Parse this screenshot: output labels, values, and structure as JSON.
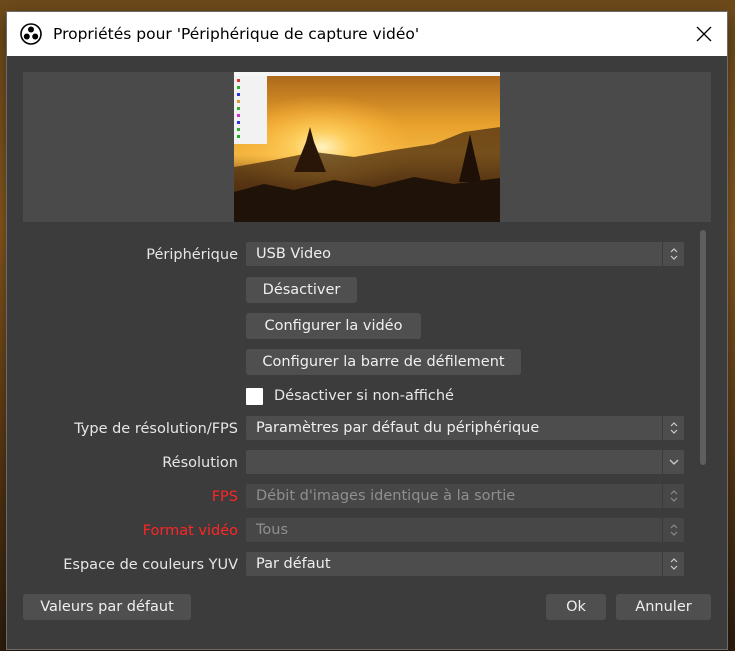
{
  "window": {
    "title": "Propriétés pour 'Périphérique de capture vidéo'"
  },
  "form": {
    "device_label": "Périphérique",
    "device_value": "USB Video",
    "deactivate_button": "Désactiver",
    "configure_video_button": "Configurer la vidéo",
    "configure_crossbar_button": "Configurer la barre de défilement",
    "deactivate_hidden_label": "Désactiver si non-affiché",
    "deactivate_hidden_checked": false,
    "res_type_label": "Type de résolution/FPS",
    "res_type_value": "Paramètres par défaut du périphérique",
    "resolution_label": "Résolution",
    "resolution_value": "",
    "fps_label": "FPS",
    "fps_value": "Débit d'images identique à la sortie",
    "video_format_label": "Format vidéo",
    "video_format_value": "Tous",
    "yuv_label": "Espace de couleurs YUV",
    "yuv_value": "Par défaut"
  },
  "footer": {
    "defaults_button": "Valeurs par défaut",
    "ok_button": "Ok",
    "cancel_button": "Annuler"
  },
  "colors": {
    "error_label": "#ff2525",
    "dialog_bg": "#3c3c3c"
  },
  "icons": {
    "app": "obs-logo-icon",
    "close": "close-icon",
    "combo_updown": "updown-chevron-icon",
    "combo_down": "chevron-down-icon"
  }
}
